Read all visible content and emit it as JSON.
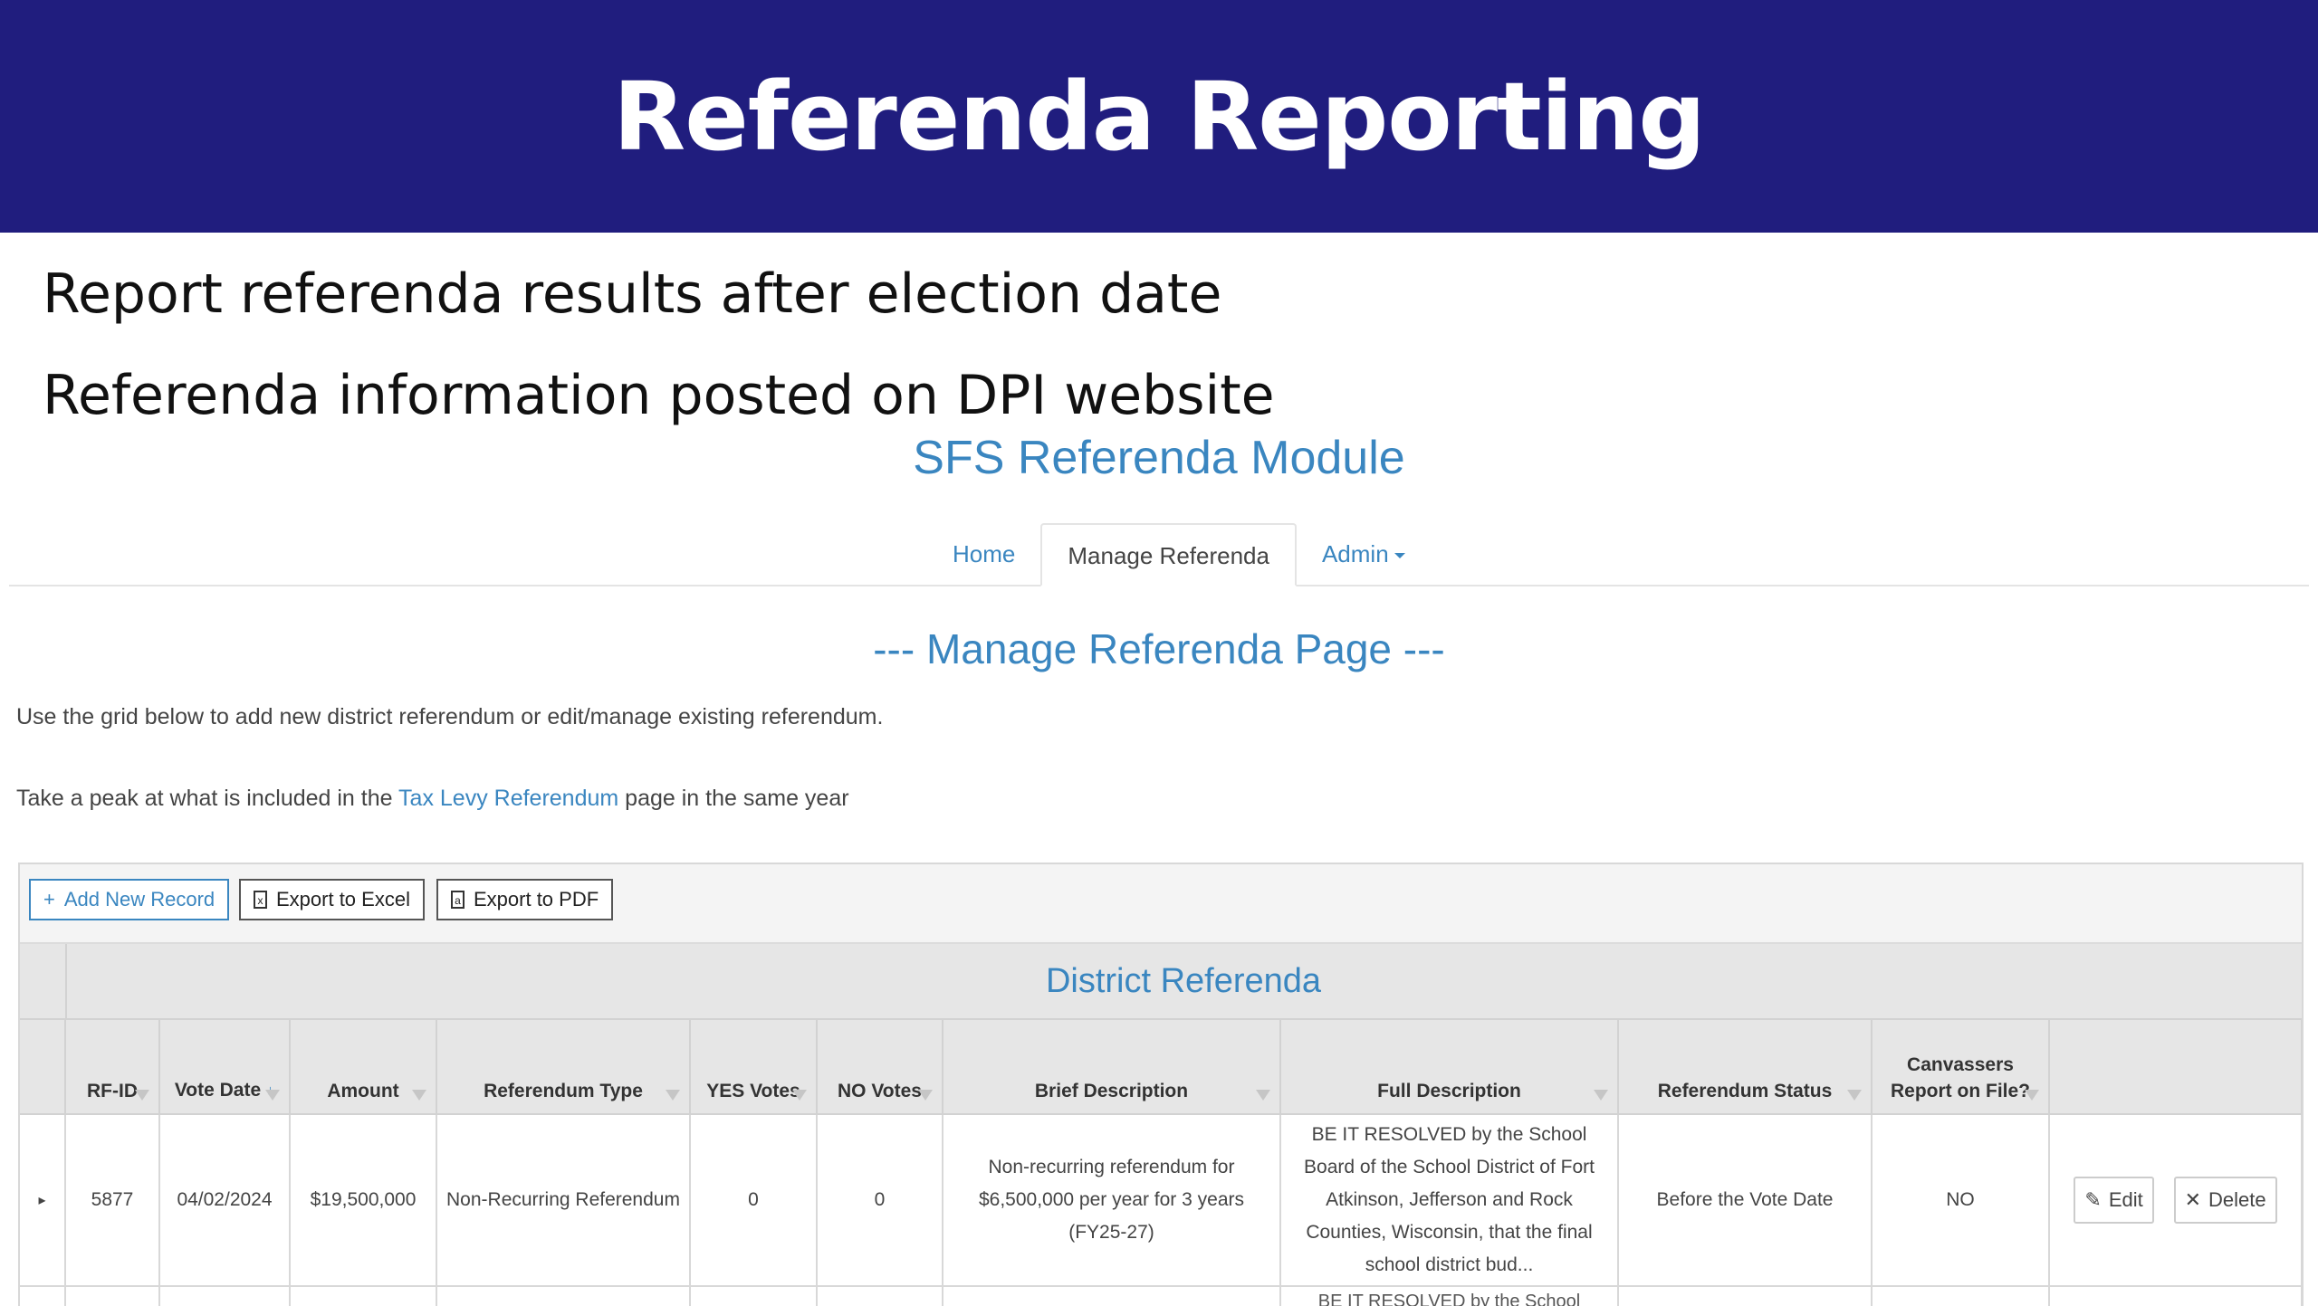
{
  "slide": {
    "title": "Referenda Reporting",
    "bullets": [
      "Report referenda results after election date",
      "Referenda information posted on DPI website"
    ]
  },
  "module_title": "SFS Referenda Module",
  "nav": {
    "items": [
      {
        "label": "Home",
        "active": false
      },
      {
        "label": "Manage Referenda",
        "active": true
      },
      {
        "label": "Admin",
        "active": false
      }
    ]
  },
  "page": {
    "heading": "--- Manage Referenda Page ---",
    "description": "Use the grid below to add new district referendum or edit/manage existing referendum.",
    "peek_prefix": "Take a peak at what is included in the ",
    "peek_link": "Tax Levy Referendum",
    "peek_suffix": " page in the same year"
  },
  "toolbar": {
    "add_label": "Add New Record",
    "excel_label": "Export to Excel",
    "pdf_label": "Export to PDF"
  },
  "grid": {
    "group_title": "District Referenda",
    "columns": [
      "RF-ID",
      "Vote Date",
      "Amount",
      "Referendum Type",
      "YES Votes",
      "NO Votes",
      "Brief Description",
      "Full Description",
      "Referendum Status",
      "Canvassers Report on File?"
    ],
    "rows": [
      {
        "rf_id": "5877",
        "vote_date": "04/02/2024",
        "amount": "$19,500,000",
        "type": "Non-Recurring Referendum",
        "yes_votes": "0",
        "no_votes": "0",
        "brief": "Non-recurring referendum for $6,500,000 per year for 3 years (FY25-27)",
        "full": "BE IT RESOLVED by the School Board of the School District of Fort Atkinson, Jefferson and Rock Counties, Wisconsin, that the final school district bud...",
        "status": "Before the Vote Date",
        "canvass": "NO",
        "edit_label": "Edit",
        "delete_label": "Delete"
      }
    ],
    "next_row_partial": "BE IT RESOLVED by the School"
  }
}
